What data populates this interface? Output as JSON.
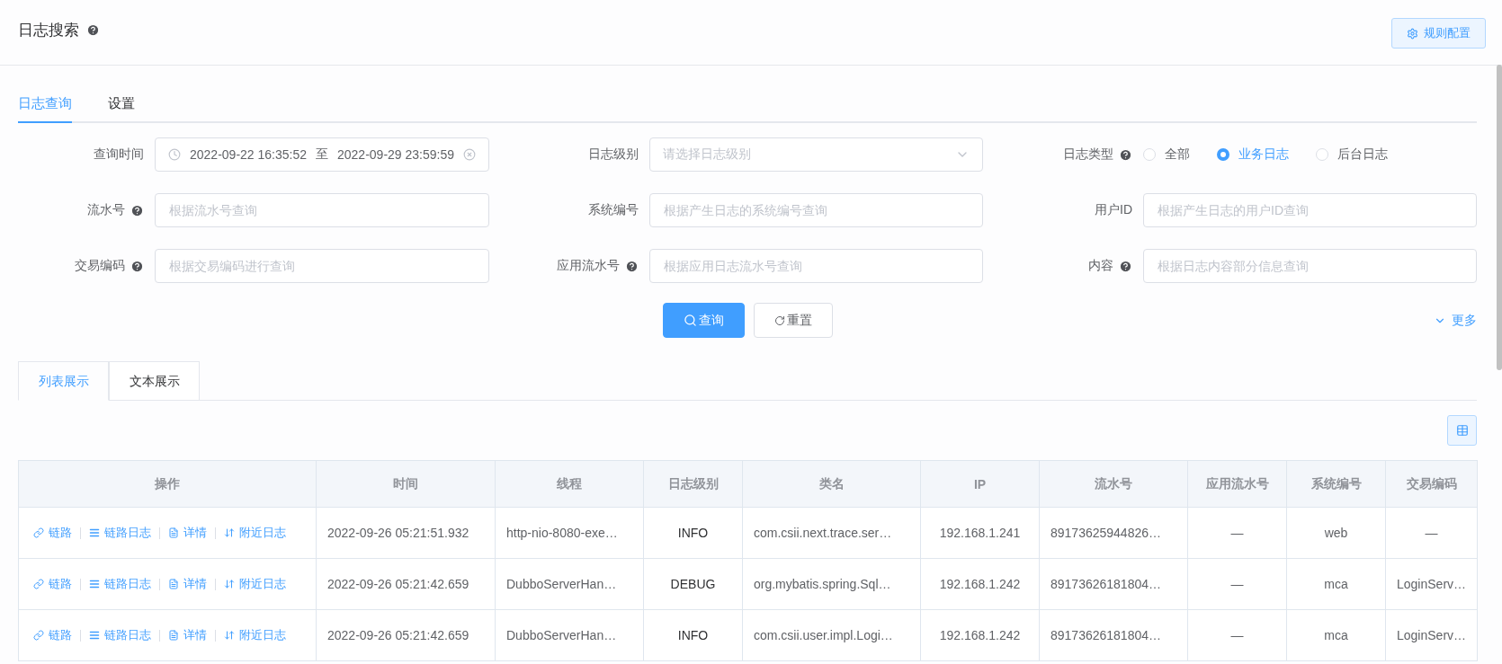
{
  "header": {
    "title": "日志搜索",
    "help": true,
    "config_button": "规则配置"
  },
  "tabs": [
    {
      "label": "日志查询",
      "selected": true
    },
    {
      "label": "设置",
      "selected": false
    }
  ],
  "form": {
    "fields": [
      {
        "kind": "daterange",
        "label": "查询时间",
        "help": false,
        "start": "2022-09-22 16:35:52",
        "separator": "至",
        "end": "2022-09-29 23:59:59"
      },
      {
        "kind": "select",
        "label": "日志级别",
        "help": false,
        "placeholder": "请选择日志级别"
      },
      {
        "kind": "radio",
        "label": "日志类型",
        "help": true,
        "options": [
          {
            "label": "全部",
            "selected": false
          },
          {
            "label": "业务日志",
            "selected": true
          },
          {
            "label": "后台日志",
            "selected": false
          }
        ]
      },
      {
        "kind": "text",
        "label": "流水号",
        "help": true,
        "placeholder": "根据流水号查询"
      },
      {
        "kind": "text",
        "label": "系统编号",
        "help": false,
        "placeholder": "根据产生日志的系统编号查询"
      },
      {
        "kind": "text",
        "label": "用户ID",
        "help": false,
        "placeholder": "根据产生日志的用户ID查询"
      },
      {
        "kind": "text",
        "label": "交易编码",
        "help": true,
        "placeholder": "根据交易编码进行查询"
      },
      {
        "kind": "text",
        "label": "应用流水号",
        "help": true,
        "placeholder": "根据应用日志流水号查询"
      },
      {
        "kind": "text",
        "label": "内容",
        "help": true,
        "placeholder": "根据日志内容部分信息查询"
      }
    ]
  },
  "actions": {
    "search": "查询",
    "reset": "重置",
    "more": "更多"
  },
  "view_tabs": [
    {
      "label": "列表展示",
      "selected": true
    },
    {
      "label": "文本展示",
      "selected": false
    }
  ],
  "table": {
    "columns": [
      "操作",
      "时间",
      "线程",
      "日志级别",
      "类名",
      "IP",
      "流水号",
      "应用流水号",
      "系统编号",
      "交易编码"
    ],
    "rows": [
      {
        "cells": [
          {
            "actions": [
              {
                "kind": "link",
                "label": "链路"
              },
              {
                "kind": "list",
                "label": "链路日志"
              },
              {
                "kind": "doc",
                "label": "详情"
              },
              {
                "kind": "sort",
                "label": "附近日志"
              }
            ]
          },
          "2022-09-26 05:21:51.932",
          "http-nio-8080-exe…",
          "INFO",
          "com.csii.next.trace.ser…",
          "192.168.1.241",
          "89173625944826…",
          "—",
          "web",
          "—"
        ]
      },
      {
        "cells": [
          {
            "actions": [
              {
                "kind": "link",
                "label": "链路"
              },
              {
                "kind": "list",
                "label": "链路日志"
              },
              {
                "kind": "doc",
                "label": "详情"
              },
              {
                "kind": "sort",
                "label": "附近日志"
              }
            ]
          },
          "2022-09-26 05:21:42.659",
          "DubboServerHan…",
          "DEBUG",
          "org.mybatis.spring.Sql…",
          "192.168.1.242",
          "89173626181804…",
          "—",
          "mca",
          "LoginServ…"
        ]
      },
      {
        "cells": [
          {
            "actions": [
              {
                "kind": "link",
                "label": "链路"
              },
              {
                "kind": "list",
                "label": "链路日志"
              },
              {
                "kind": "doc",
                "label": "详情"
              },
              {
                "kind": "sort",
                "label": "附近日志"
              }
            ]
          },
          "2022-09-26 05:21:42.659",
          "DubboServerHan…",
          "INFO",
          "com.csii.user.impl.Logi…",
          "192.168.1.242",
          "89173626181804…",
          "—",
          "mca",
          "LoginServ…"
        ]
      }
    ]
  }
}
